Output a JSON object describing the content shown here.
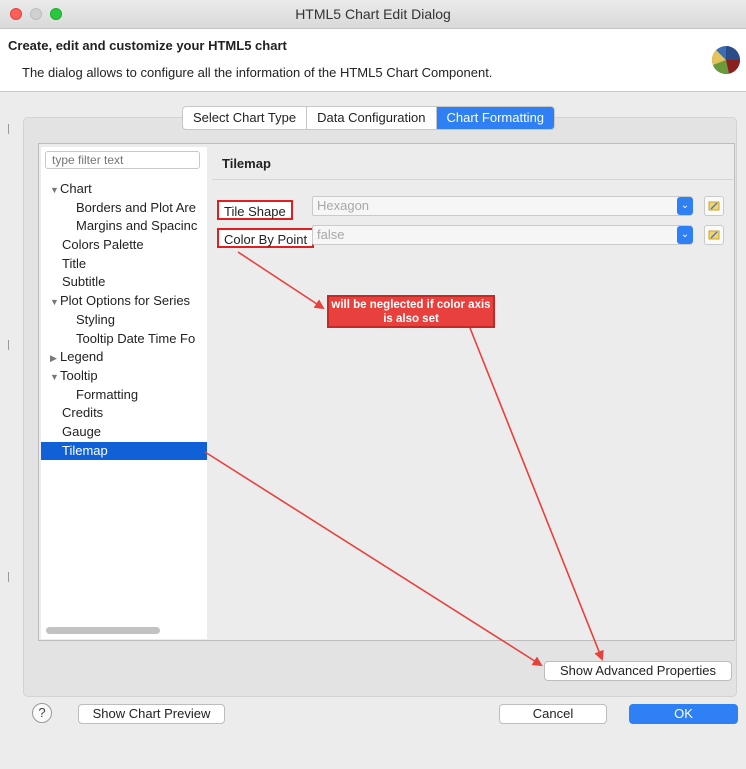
{
  "window": {
    "title": "HTML5 Chart Edit Dialog"
  },
  "header": {
    "title": "Create, edit and customize your HTML5 chart",
    "description": "The dialog allows to configure all the information of the HTML5 Chart Component."
  },
  "tabs": [
    {
      "label": "Select Chart Type",
      "active": false
    },
    {
      "label": "Data Configuration",
      "active": false
    },
    {
      "label": "Chart Formatting",
      "active": true
    }
  ],
  "sidebar": {
    "filter_placeholder": "type filter text",
    "items": [
      {
        "label": "Chart",
        "level": 0,
        "expander": "expanded"
      },
      {
        "label": "Borders and Plot Are",
        "level": 1
      },
      {
        "label": "Margins and Spacinc",
        "level": 1
      },
      {
        "label": "Colors Palette",
        "level": 0
      },
      {
        "label": "Title",
        "level": 0
      },
      {
        "label": "Subtitle",
        "level": 0
      },
      {
        "label": "Plot Options for Series",
        "level": 0,
        "expander": "expanded"
      },
      {
        "label": "Styling",
        "level": 1
      },
      {
        "label": "Tooltip Date Time Fo",
        "level": 1
      },
      {
        "label": "Legend",
        "level": 0,
        "expander": "collapsed"
      },
      {
        "label": "Tooltip",
        "level": 0,
        "expander": "expanded"
      },
      {
        "label": "Formatting",
        "level": 1
      },
      {
        "label": "Credits",
        "level": 0
      },
      {
        "label": "Gauge",
        "level": 0
      },
      {
        "label": "Tilemap",
        "level": 0,
        "selected": true
      }
    ]
  },
  "content": {
    "title": "Tilemap",
    "rows": [
      {
        "label": "Tile Shape",
        "value": "Hexagon"
      },
      {
        "label": "Color By Point",
        "value": "false"
      }
    ],
    "annotation": "will be neglected if color axis is also set"
  },
  "buttons": {
    "advanced": "Show Advanced Properties",
    "preview": "Show Chart Preview",
    "cancel": "Cancel",
    "ok": "OK",
    "help": "?"
  },
  "colors": {
    "accent": "#2f7ff5",
    "selection": "#1060d8",
    "annotation": "#e8413d"
  }
}
